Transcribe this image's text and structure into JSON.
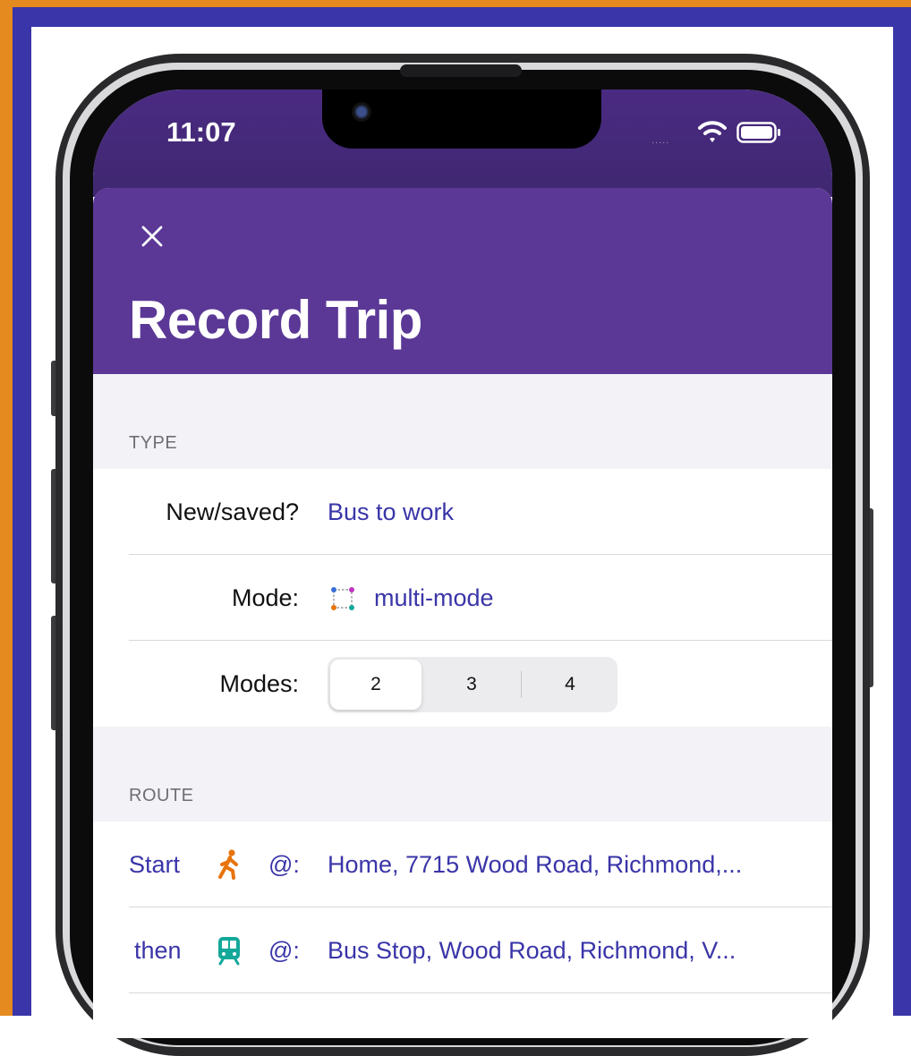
{
  "status_bar": {
    "time": "11:07",
    "signal": "....."
  },
  "header": {
    "title": "Record Trip"
  },
  "icons": {
    "close": "close-icon",
    "wifi": "wifi-icon",
    "battery": "battery-icon",
    "mode": "multi-mode-icon",
    "start_mode": "walking-icon",
    "then_mode": "train-icon"
  },
  "colors": {
    "nav_background": "#5b3896",
    "link_blue": "#3a35a8",
    "walk_orange": "#e8740c",
    "train_teal": "#14a89a"
  },
  "type_section": {
    "header": "TYPE",
    "new_saved_label": "New/saved?",
    "new_saved_value": "Bus to work",
    "mode_label": "Mode:",
    "mode_value": "multi-mode",
    "modes_label": "Modes:",
    "modes_options": [
      "2",
      "3",
      "4"
    ],
    "modes_selected": "2"
  },
  "route_section": {
    "header": "ROUTE",
    "rows": [
      {
        "label": "Start",
        "at": "@:",
        "location": "Home, 7715 Wood Road, Richmond,..."
      },
      {
        "label": "then",
        "at": "@:",
        "location": "Bus Stop, Wood Road, Richmond, V..."
      }
    ]
  }
}
